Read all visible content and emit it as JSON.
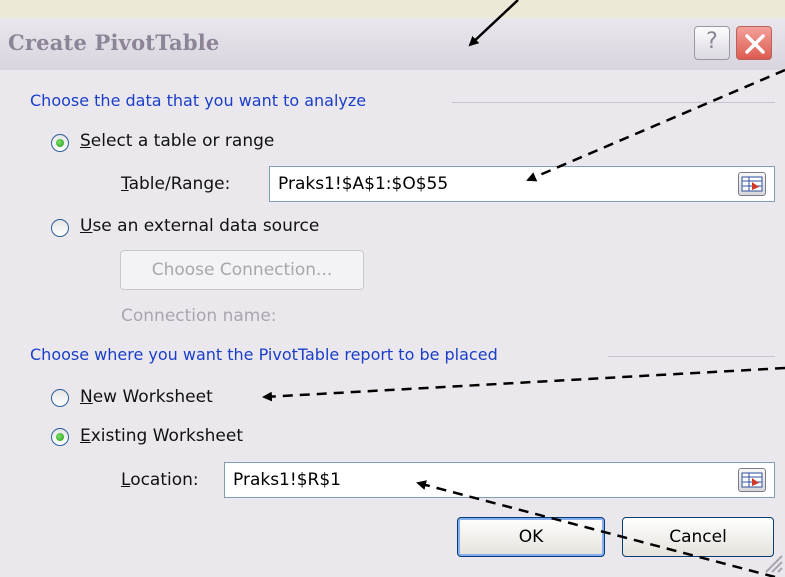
{
  "window": {
    "title": "Create PivotTable",
    "help": "?"
  },
  "analyze": {
    "header": "Choose the data that you want to analyze",
    "select_table": {
      "mnemonic": "S",
      "rest": "elect a table or range",
      "selected": true
    },
    "table_range": {
      "mnemonic": "T",
      "rest": "able/Range:",
      "value": "Praks1!$A$1:$O$55"
    },
    "external": {
      "mnemonic": "U",
      "rest": "se an external data source",
      "selected": false
    },
    "choose_connection": "Choose Connection...",
    "connection_name": "Connection name:"
  },
  "placement": {
    "header": "Choose where you want the PivotTable report to be placed",
    "new_ws": {
      "mnemonic": "N",
      "rest": "ew Worksheet",
      "selected": false
    },
    "existing_ws": {
      "mnemonic": "E",
      "rest": "xisting Worksheet",
      "selected": true
    },
    "location": {
      "mnemonic": "L",
      "rest": "ocation:",
      "value": "Praks1!$R$1"
    }
  },
  "buttons": {
    "ok": "OK",
    "cancel": "Cancel"
  },
  "colors": {
    "section_header": "#1a3ec9",
    "title_text": "#8d8597"
  }
}
